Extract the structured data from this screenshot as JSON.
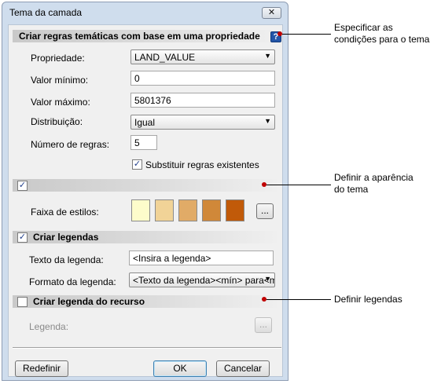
{
  "window": {
    "title": "Tema da camada",
    "close_glyph": "✕"
  },
  "section_rules": {
    "title": "Criar regras temáticas com base em uma propriedade",
    "help_icon": "?",
    "property_label": "Propriedade:",
    "property_value": "LAND_VALUE",
    "min_label": "Valor mínimo:",
    "min_value": "0",
    "max_label": "Valor máximo:",
    "max_value": "5801376",
    "distribution_label": "Distribuição:",
    "distribution_value": "Igual",
    "rule_count_label": "Número de regras:",
    "rule_count_value": "5",
    "replace_label": "Substituir regras existentes",
    "replace_checked": true
  },
  "section_appearance": {
    "checked": true,
    "style_range_label": "Faixa de estilos:",
    "swatches": [
      "#fdfccb",
      "#f1d397",
      "#e1ab67",
      "#d08839",
      "#c15a09"
    ],
    "browse_label": "..."
  },
  "section_legends": {
    "title": "Criar legendas",
    "checked": true,
    "legend_text_label": "Texto da legenda:",
    "legend_text_value": "<Insira a legenda>",
    "legend_format_label": "Formato da legenda:",
    "legend_format_value": "<Texto da legenda><mín> para<m"
  },
  "section_feature_legend": {
    "title": "Criar legenda do recurso",
    "checked": false,
    "legend_label": "Legenda:",
    "browse_label": "..."
  },
  "buttons": {
    "reset": "Redefinir",
    "ok": "OK",
    "cancel": "Cancelar"
  },
  "callouts": {
    "conditions": "Especificar as\ncondições para o tema",
    "appearance": "Definir a aparência\ndo tema",
    "legends": "Definir legendas"
  },
  "glyphs": {
    "check": "✓",
    "dropdown": "▼"
  }
}
